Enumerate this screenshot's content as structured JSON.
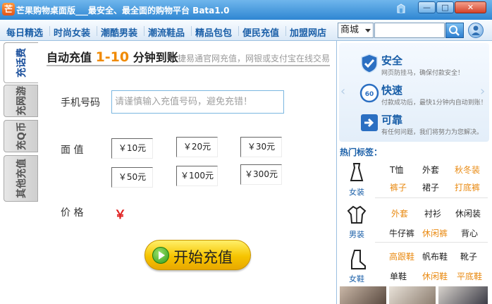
{
  "window": {
    "logo_char": "芒",
    "title": "芒果购物桌面版___最安全、最全面的购物平台  Bata1.0",
    "min_symbol": "—",
    "max_symbol": "□",
    "close_symbol": "✕"
  },
  "nav": {
    "items": [
      "每日精选",
      "时尚女装",
      "潮酷男装",
      "潮流鞋品",
      "精品包包",
      "便民充值",
      "加盟网店"
    ],
    "select_value": "商城",
    "search_placeholder": ""
  },
  "side_tabs": [
    {
      "label": "充话费",
      "active": true
    },
    {
      "label": "充网游",
      "active": false
    },
    {
      "label": "充Q币",
      "active": false
    },
    {
      "label": "其他充值",
      "active": false
    }
  ],
  "main": {
    "title_pre": "自动充值 ",
    "title_hl": "1-10",
    "title_post": " 分钟到账",
    "subtitle": "捷易通官网充值，网银或支付宝在线交易",
    "phone_label": "手机号码",
    "phone_placeholder": "请谨慎输入充值号码，避免充错！",
    "amount_label": "面  值",
    "amounts": [
      "￥10元",
      "￥20元",
      "￥30元",
      "￥50元",
      "￥100元",
      "￥300元"
    ],
    "price_label": "价  格",
    "price_value": "￥",
    "start_label": "开始充值"
  },
  "features": [
    {
      "icon": "shield-icon",
      "title": "安全",
      "desc": "网页防挂马，确保付款安全！"
    },
    {
      "icon": "speed-60s-icon",
      "title": "快速",
      "desc": "付款成功后，最快1分钟内自动到账！"
    },
    {
      "icon": "exit-arrow-icon",
      "title": "可靠",
      "desc": "有任何问题，我们将努力为您解决。"
    }
  ],
  "hot_tags": {
    "title": "热门标签：",
    "categories": [
      {
        "name": "女装",
        "icon": "dress-icon",
        "tags": [
          {
            "text": "T恤",
            "color": "black"
          },
          {
            "text": "外套",
            "color": "black"
          },
          {
            "text": "秋冬装",
            "color": "orange"
          },
          {
            "text": "裤子",
            "color": "orange"
          },
          {
            "text": "裙子",
            "color": "black"
          },
          {
            "text": "打底裤",
            "color": "orange"
          }
        ]
      },
      {
        "name": "男装",
        "icon": "jacket-icon",
        "tags": [
          {
            "text": "外套",
            "color": "orange"
          },
          {
            "text": "衬衫",
            "color": "black"
          },
          {
            "text": "休闲装",
            "color": "black"
          },
          {
            "text": "牛仔裤",
            "color": "black"
          },
          {
            "text": "休闲裤",
            "color": "orange"
          },
          {
            "text": "背心",
            "color": "black"
          }
        ]
      },
      {
        "name": "女鞋",
        "icon": "boot-icon",
        "tags": [
          {
            "text": "高跟鞋",
            "color": "orange"
          },
          {
            "text": "帆布鞋",
            "color": "black"
          },
          {
            "text": "靴子",
            "color": "black"
          },
          {
            "text": "单鞋",
            "color": "black"
          },
          {
            "text": "休闲鞋",
            "color": "orange"
          },
          {
            "text": "平底鞋",
            "color": "orange"
          }
        ]
      }
    ]
  },
  "colors": {
    "accent_blue": "#1a5fa8",
    "highlight_orange": "#f08a00",
    "tag_orange": "#e98a12",
    "price_red": "#e02020",
    "start_button_yellow": "#f6c400"
  }
}
